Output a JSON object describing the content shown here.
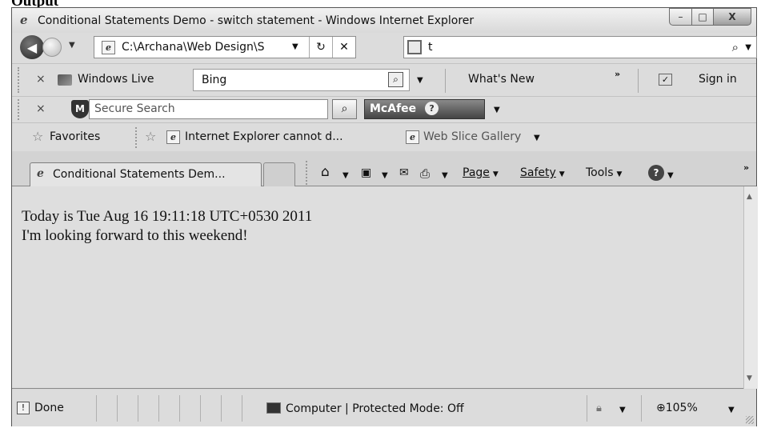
{
  "caption": {
    "heading": "Output"
  },
  "window": {
    "title": "Conditional Statements Demo - switch statement - Windows Internet Explorer",
    "minimize": "–",
    "maximize": "□",
    "close": "X"
  },
  "address_bar": {
    "url": "C:\\Archana\\Web Design\\S",
    "refresh_glyph": "↻",
    "stop_glyph": "✕"
  },
  "search": {
    "value": "t",
    "search_glyph": "⌕"
  },
  "windows_live_toolbar": {
    "close": "×",
    "label": "Windows Live",
    "search_value": "Bing",
    "whats_new": "What's New",
    "more": "»",
    "sign_in": "Sign in"
  },
  "mcafee_toolbar": {
    "close": "×",
    "placeholder": "Secure Search",
    "brand": "McAfee",
    "help": "?"
  },
  "favorites_bar": {
    "favorites_label": "Favorites",
    "items": [
      {
        "label": "Internet Explorer cannot d..."
      },
      {
        "label": "Web Slice Gallery"
      }
    ]
  },
  "tabs": [
    {
      "label": "Conditional Statements Dem..."
    }
  ],
  "command_bar": {
    "page": "Page",
    "safety": "Safety",
    "tools": "Tools",
    "help": "?",
    "more": "»"
  },
  "content": {
    "lines": [
      "Today is Tue Aug 16 19:11:18 UTC+0530 2011",
      "I'm looking forward to this weekend!"
    ]
  },
  "status_bar": {
    "status": "Done",
    "zone": "Computer | Protected Mode: Off",
    "zoom": "105%"
  }
}
